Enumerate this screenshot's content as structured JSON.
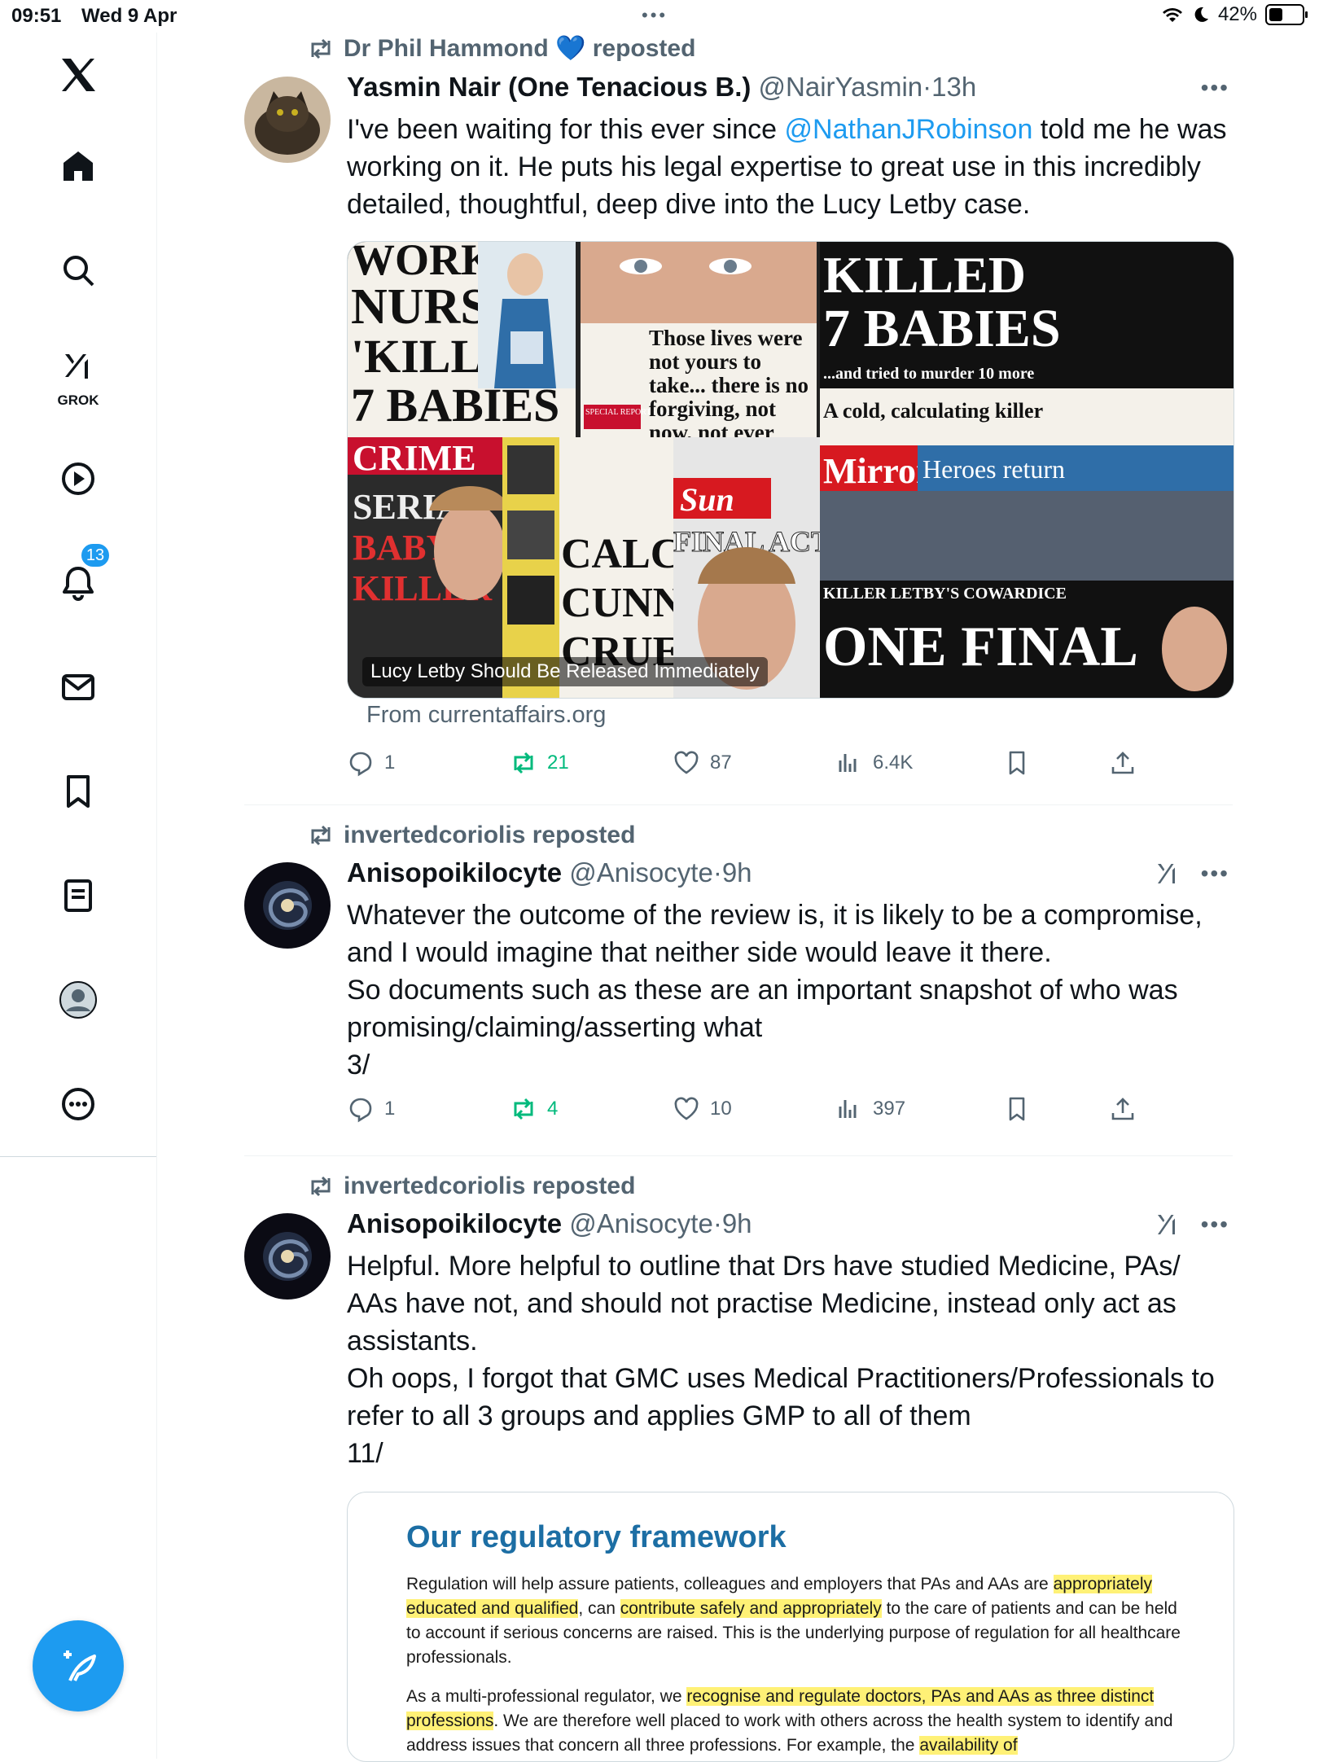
{
  "status_bar": {
    "time": "09:51",
    "date": "Wed 9 Apr",
    "battery": "42%",
    "battery_level": 0.42
  },
  "sidebar": {
    "grok_label": "GROK",
    "notifications_badge": "13",
    "items": [
      "x-logo-icon",
      "home-icon",
      "search-icon",
      "grok-icon",
      "video-icon",
      "notifications-icon",
      "messages-icon",
      "bookmarks-icon",
      "lists-icon",
      "profile-icon",
      "more-icon"
    ]
  },
  "colors": {
    "accent": "#1d9bf0",
    "repost_green": "#00ba7c",
    "muted": "#536471",
    "highlight": "#fff176"
  },
  "posts": [
    {
      "repost_label": "Dr Phil Hammond 💙 reposted",
      "author": "Yasmin Nair (One Tenacious B.)",
      "handle": "@NairYasmin",
      "time": "13h",
      "text_pre": "I've been waiting for this ever since ",
      "mention": "@NathanJRobinson",
      "text_post": "  told me he was working on it. He puts his legal expertise to great use in this incredibly detailed, thoughtful, deep dive into the Lucy Letby case.",
      "media": {
        "caption": "Lucy Letby Should Be Released Immediately",
        "headlines": {
          "a1": "WORK",
          "a2": "NURSE",
          "a3": "'KILLED'",
          "a4": "7 BABIES",
          "quote": "Those lives were not yours to take... there is no forgiving, not now, not ever",
          "special": "SPECIAL REPORTS & ANALYSIS",
          "killed": "KILLED",
          "babies": "7 BABIES",
          "tried": "...and tried to murder 10 more",
          "cold": "A cold, calculating killer",
          "mirror": "Mirror",
          "heroes": "Heroes return",
          "cowardice": "KILLER LETBY'S COWARDICE",
          "one_final": "ONE FINAL",
          "crime": "CRIME",
          "serial": "SERIAL",
          "baby": "BABY",
          "killer": "KILLER",
          "sun": "Sun",
          "final_act": "FINAL ACT OF",
          "calcu": "CALCU",
          "cunnin": "CUNNIN",
          "cruel": "CRUEL"
        }
      },
      "link_source": "From currentaffairs.org",
      "replies": "1",
      "reposts": "21",
      "likes": "87",
      "views": "6.4K"
    },
    {
      "repost_label": "invertedcoriolis reposted",
      "author": "Anisopoikilocyte",
      "handle": "@Anisocyte",
      "time": "9h",
      "lines": [
        "Whatever the outcome of the review is, it is likely to be a compromise,",
        "and I would imagine that neither side would leave it there.",
        "So documents such as these are an important snapshot of who was",
        "promising/claiming/asserting what",
        "3/"
      ],
      "replies": "1",
      "reposts": "4",
      "likes": "10",
      "views": "397"
    },
    {
      "repost_label": "invertedcoriolis reposted",
      "author": "Anisopoikilocyte",
      "handle": "@Anisocyte",
      "time": "9h",
      "lines": [
        "Helpful. More helpful to outline that Drs have studied Medicine, PAs/",
        "AAs have not, and should not practise Medicine, instead only act as",
        "assistants.",
        "Oh oops, I forgot that GMC uses Medical Practitioners/Professionals to",
        "refer to all 3 groups and applies GMP to all of them",
        "11/"
      ],
      "document": {
        "title": "Our regulatory framework",
        "p1_a": "Regulation will help assure patients, colleagues and employers that PAs and AAs are",
        "p1_hl1": "appropriately educated and qualified",
        "p1_b": ", can ",
        "p1_hl2": "contribute safely and appropriately",
        "p1_c": " to the care of patients and can be held to account if serious concerns are raised. This is the underlying purpose of regulation for all healthcare professionals.",
        "p2_a": "As a multi-professional regulator, we ",
        "p2_hl1": "recognise and regulate doctors, PAs and AAs as three distinct professions",
        "p2_b": ". We are therefore well placed to work with others across the health system to identify and address issues that concern all three professions. For example, the ",
        "p2_hl2": "availability of"
      }
    }
  ]
}
